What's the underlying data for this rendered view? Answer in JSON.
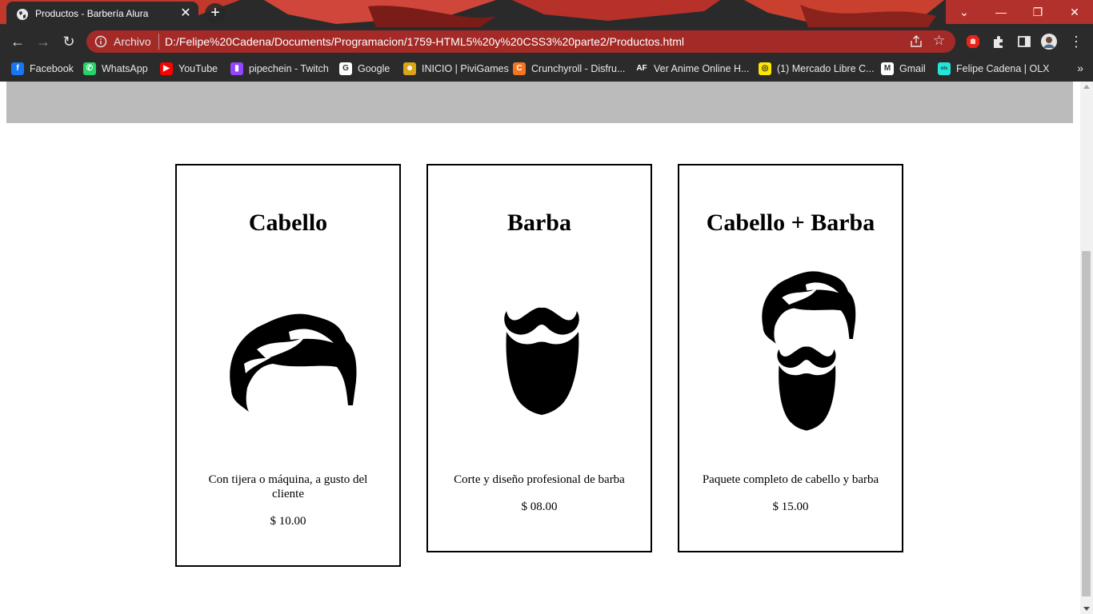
{
  "browser": {
    "tab_title": "Productos - Barbería Alura",
    "tab_close": "✕",
    "new_tab": "+",
    "scheme_label": "Archivo",
    "url": "D:/Felipe%20Cadena/Documents/Programacion/1759-HTML5%20y%20CSS3%20parte2/Productos.html",
    "window_controls": {
      "tab_search": "⌄",
      "minimize": "—",
      "maximize": "❐",
      "close": "✕"
    },
    "bookmarks": [
      {
        "label": "Facebook",
        "icon": "facebook-icon",
        "color": "#1877f2",
        "glyph": "f"
      },
      {
        "label": "WhatsApp",
        "icon": "whatsapp-icon",
        "color": "#25d366",
        "glyph": "✆"
      },
      {
        "label": "YouTube",
        "icon": "youtube-icon",
        "color": "#ff0000",
        "glyph": "▶"
      },
      {
        "label": "pipechein - Twitch",
        "icon": "twitch-icon",
        "color": "#9146ff",
        "glyph": "▮"
      },
      {
        "label": "Google",
        "icon": "google-icon",
        "color": "#ffffff",
        "glyph": "G"
      },
      {
        "label": "INICIO | PiviGames",
        "icon": "pivigames-icon",
        "color": "#d9a514",
        "glyph": "☻"
      },
      {
        "label": "Crunchyroll - Disfru...",
        "icon": "crunchyroll-icon",
        "color": "#f47521",
        "glyph": "C"
      },
      {
        "label": "Ver Anime Online H...",
        "icon": "animeflv-icon",
        "color": "#2b2b2b",
        "glyph": "AF"
      },
      {
        "label": "(1) Mercado Libre C...",
        "icon": "mercadolibre-icon",
        "color": "#ffe600",
        "glyph": "◎"
      },
      {
        "label": "Gmail",
        "icon": "gmail-icon",
        "color": "#ffffff",
        "glyph": "M"
      },
      {
        "label": "Felipe Cadena | OLX",
        "icon": "olx-icon",
        "color": "#23e5db",
        "glyph": "olx"
      }
    ],
    "bookmarks_more": "»",
    "accent": "#a32a26"
  },
  "products": [
    {
      "name": "Cabello",
      "description": "Con tijera o máquina, a gusto del cliente",
      "price": "$ 10.00",
      "icon": "hair-icon"
    },
    {
      "name": "Barba",
      "description": "Corte y diseño profesional de barba",
      "price": "$ 08.00",
      "icon": "beard-icon"
    },
    {
      "name": "Cabello + Barba",
      "description": "Paquete completo de cabello y barba",
      "price": "$ 15.00",
      "icon": "hair-and-beard-icon"
    }
  ]
}
